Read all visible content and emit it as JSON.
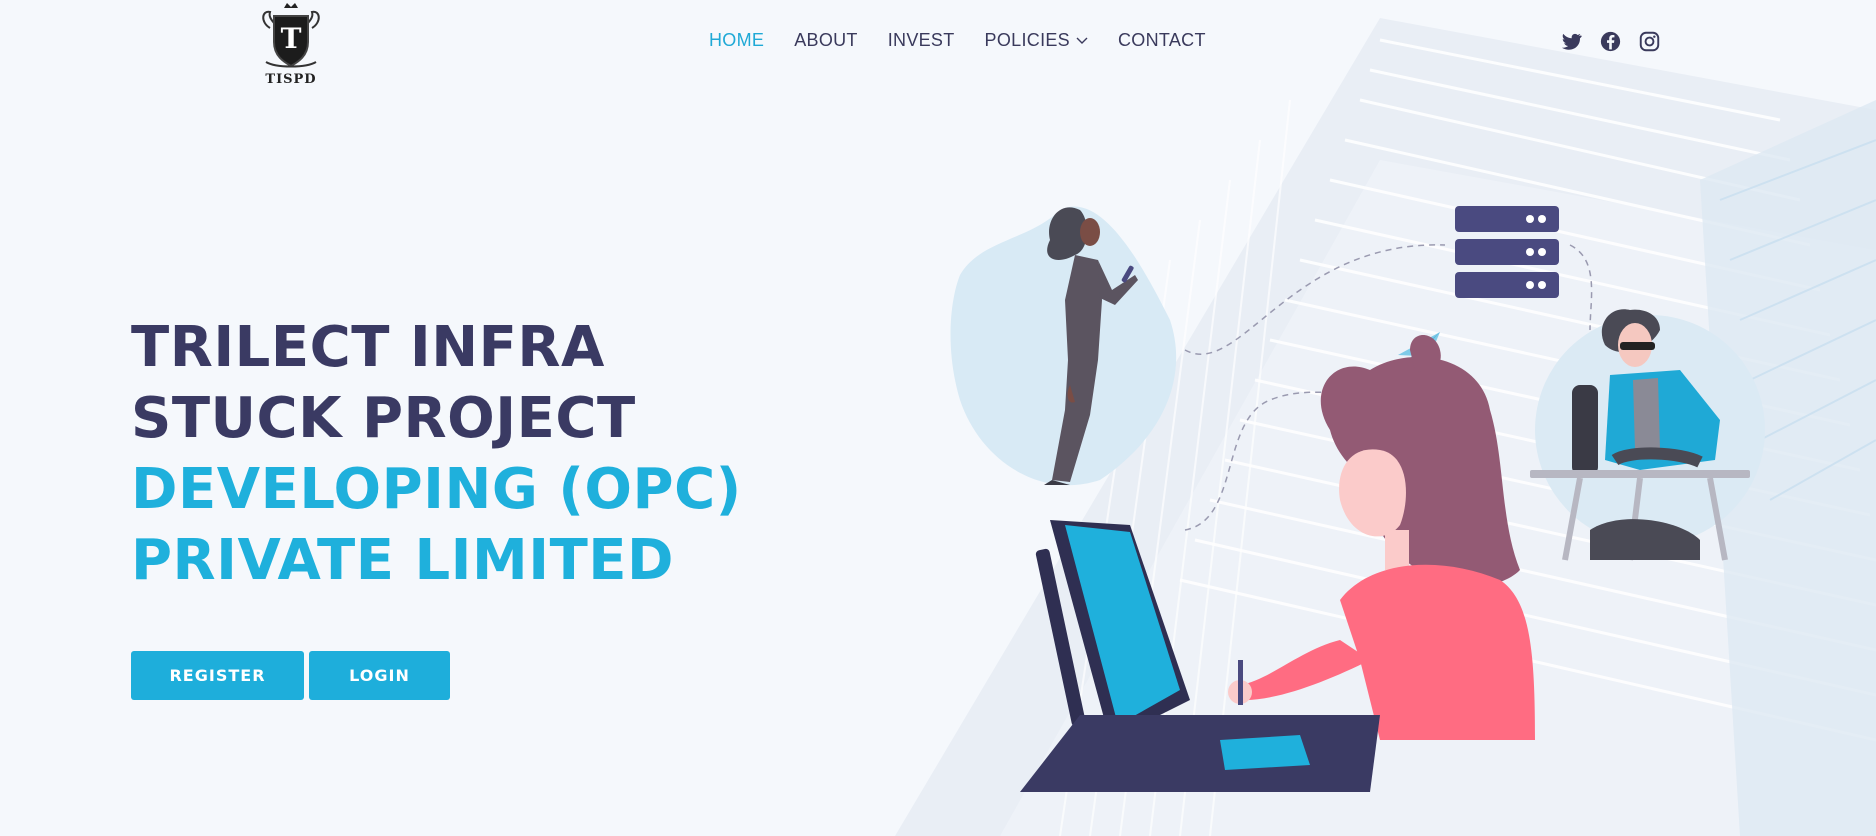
{
  "logo": {
    "text": "TISPD",
    "icon": "shield-crest-logo"
  },
  "nav": {
    "items": [
      {
        "label": "HOME",
        "active": true
      },
      {
        "label": "ABOUT",
        "active": false
      },
      {
        "label": "INVEST",
        "active": false
      },
      {
        "label": "POLICIES",
        "active": false,
        "dropdown": true
      },
      {
        "label": "CONTACT",
        "active": false
      }
    ]
  },
  "social": {
    "icons": [
      "twitter-icon",
      "facebook-icon",
      "instagram-icon"
    ]
  },
  "hero": {
    "line1": "TRILECT INFRA",
    "line2": "STUCK PROJECT",
    "line3": "DEVELOPING (OPC)",
    "line4": "PRIVATE LIMITED"
  },
  "buttons": {
    "register": "REGISTER",
    "login": "LOGIN"
  },
  "colors": {
    "accent": "#1eaedb",
    "heading_dark": "#3a3a63",
    "background": "#f5f8fc"
  }
}
